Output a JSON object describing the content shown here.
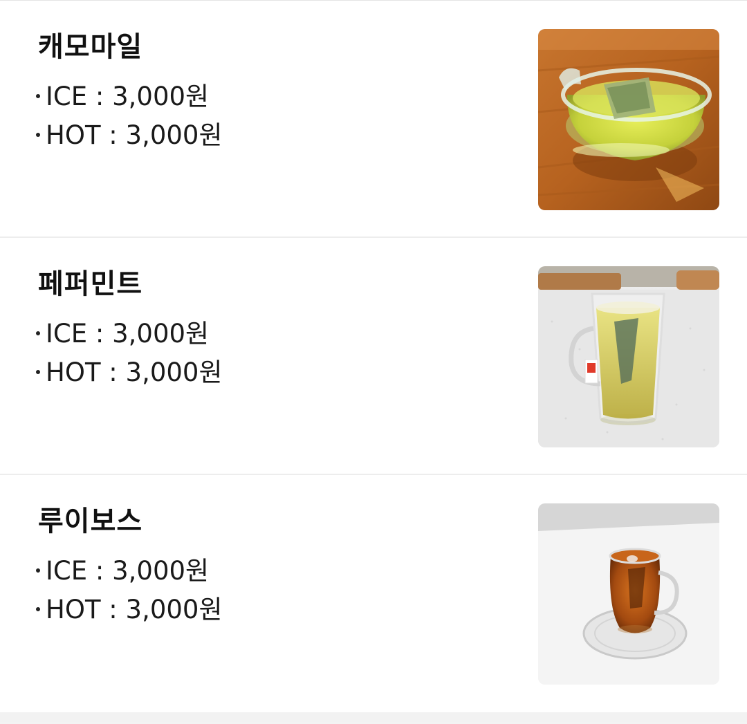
{
  "menu": {
    "items": [
      {
        "name": "캐모마일",
        "ice_label": "ICE",
        "ice_price": "3,000원",
        "hot_label": "HOT",
        "hot_price": "3,000원",
        "photo": "chamomile-tea-cup-on-wooden-table"
      },
      {
        "name": "페퍼민트",
        "ice_label": "ICE",
        "ice_price": "3,000원",
        "hot_label": "HOT",
        "hot_price": "3,000원",
        "photo": "peppermint-tea-glass-mug-on-white-counter"
      },
      {
        "name": "루이보스",
        "ice_label": "ICE",
        "ice_price": "3,000원",
        "hot_label": "HOT",
        "hot_price": "3,000원",
        "photo": "rooibos-tea-glass-cup-on-saucer"
      }
    ],
    "separator": " : "
  },
  "colors": {
    "background": "#ffffff",
    "divider": "#ededed",
    "text": "#111111"
  }
}
